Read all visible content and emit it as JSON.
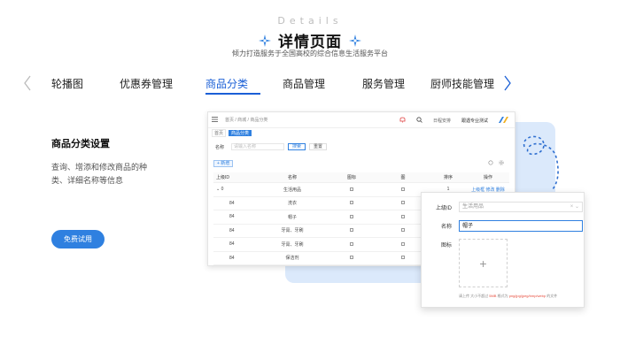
{
  "header": {
    "subtitle": "Details",
    "title": "详情页面",
    "description": "倾力打造服务于全国高校的综合信息生活服务平台"
  },
  "tabs": [
    {
      "label": "轮播图",
      "active": false
    },
    {
      "label": "优惠券管理",
      "active": false
    },
    {
      "label": "商品分类",
      "active": true
    },
    {
      "label": "商品管理",
      "active": false
    },
    {
      "label": "服务管理",
      "active": false
    },
    {
      "label": "厨师技能管理",
      "active": false
    }
  ],
  "section": {
    "title": "商品分类设置",
    "description": "查询、增添和修改商品的种类、详细名称等信息",
    "trial_button": "免费试用"
  },
  "window": {
    "breadcrumb": "首页 / 商城 / 商品分类",
    "search_label": "日程安排",
    "user_label": "跟遇专业测试",
    "tags": [
      "首页",
      "商品分类"
    ],
    "search": {
      "field_label": "名称",
      "placeholder": "请输入名称",
      "search_button": "搜索",
      "reset_button": "重置"
    },
    "add_button": "+ 新增",
    "table": {
      "headers": [
        "上级ID",
        "名称",
        "图标",
        "图",
        "排序",
        "操作"
      ],
      "rows": [
        {
          "id": "0",
          "name": "生活用品",
          "sort": "1",
          "actions": "上级框 修改 删除"
        },
        {
          "id": "84",
          "name": "洗衣",
          "sort": "",
          "actions": ""
        },
        {
          "id": "84",
          "name": "帽子",
          "sort": "",
          "actions": ""
        },
        {
          "id": "84",
          "name": "牙膏、牙刷",
          "sort": "",
          "actions": ""
        },
        {
          "id": "84",
          "name": "牙膏、牙刷",
          "sort": "",
          "actions": ""
        },
        {
          "id": "84",
          "name": "保洁剂",
          "sort": "",
          "actions": ""
        }
      ]
    }
  },
  "dialog": {
    "parent_label": "上级ID",
    "parent_value": "生活用品",
    "name_label": "名称",
    "name_value": "帽子",
    "icon_label": "图标",
    "hint_prefix": "请上传 大小不超过",
    "hint_size": "5MB",
    "hint_middle": "格式为",
    "hint_formats": "png/jpg/jpeg/bmp/webp",
    "hint_suffix": "的文件"
  },
  "colors": {
    "accent": "#1a5fd6",
    "button": "#2f80e0",
    "panel_bg": "#dbe9fb"
  }
}
